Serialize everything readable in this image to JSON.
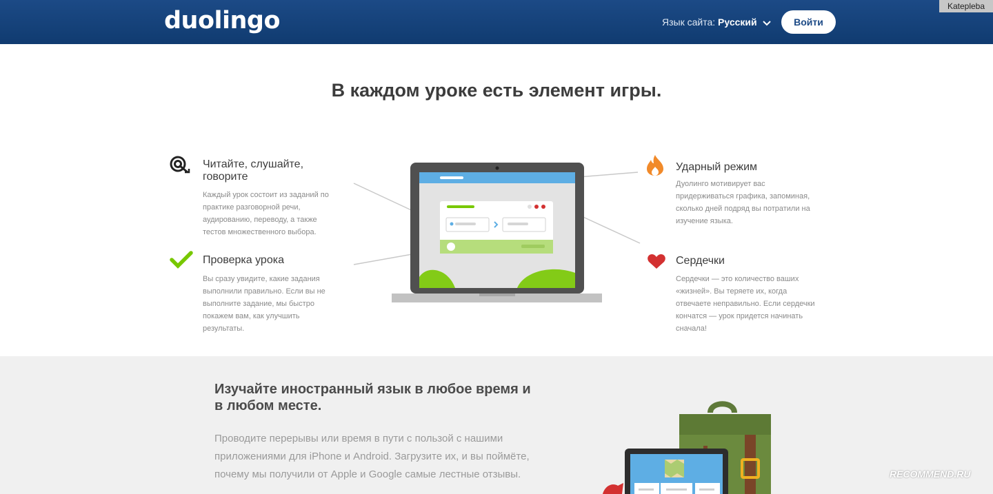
{
  "header": {
    "logo": "duolingo",
    "lang_label": "Язык сайта:",
    "lang_value": "Русский",
    "login_label": "Войти"
  },
  "watermark_top": "Katepleba",
  "section1": {
    "title": "В каждом уроке есть элемент игры.",
    "features": [
      {
        "icon": "target-icon",
        "title": "Читайте, слушайте, говорите",
        "lines": [
          "Каждый урок состоит из заданий по",
          "практике разговорной речи,",
          "аудированию, переводу, а также",
          "тестов множественного выбора."
        ]
      },
      {
        "icon": "checkmark-icon",
        "title": "Проверка урока",
        "lines": [
          "Вы сразу увидите, какие задания",
          "выполнили правильно. Если вы не",
          "выполните задание, мы быстро",
          "покажем вам, как улучшить",
          "результаты."
        ]
      },
      {
        "icon": "flame-icon",
        "title": "Ударный режим",
        "lines": [
          "Дуолинго мотивирует вас",
          "придерживаться графика, запоминая,",
          "сколько дней подряд вы потратили на",
          "изучение языка."
        ]
      },
      {
        "icon": "heart-icon",
        "title": "Сердечки",
        "lines": [
          "Сердечки — это количество ваших",
          "«жизней». Вы теряете их, когда",
          "отвечаете неправильно. Если сердечки",
          "кончатся — урок придется начинать",
          "сначала!"
        ]
      }
    ]
  },
  "section2": {
    "title": "Изучайте иностранный язык в любое время и в любом месте.",
    "text": "Проводите перерывы или время в пути с пользой с нашими приложениями для iPhone и Android. Загрузите их, и вы поймёте, почему мы получили от Apple и Google самые лестные отзывы."
  },
  "watermark_bottom": "RECOMMEND.RU",
  "colors": {
    "header": "#1c4a86",
    "green": "#78c800",
    "orange": "#f18a2a",
    "red": "#d33131"
  }
}
